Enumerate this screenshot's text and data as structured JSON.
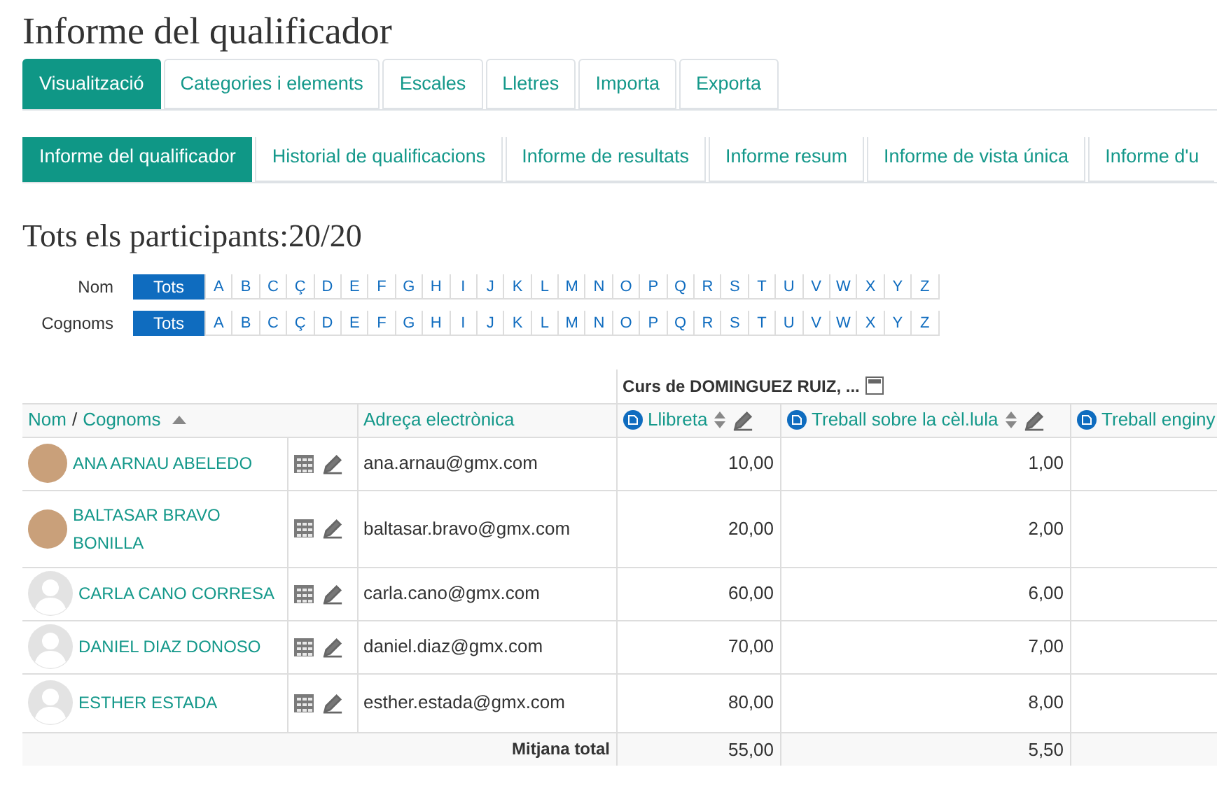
{
  "page_title": "Informe del qualificador",
  "main_tabs": [
    {
      "label": "Visualització",
      "selected": true
    },
    {
      "label": "Categories i elements",
      "selected": false
    },
    {
      "label": "Escales",
      "selected": false
    },
    {
      "label": "Lletres",
      "selected": false
    },
    {
      "label": "Importa",
      "selected": false
    },
    {
      "label": "Exporta",
      "selected": false
    }
  ],
  "sub_tabs": [
    {
      "label": "Informe del qualificador",
      "selected": true
    },
    {
      "label": "Historial de qualificacions",
      "selected": false
    },
    {
      "label": "Informe de resultats",
      "selected": false
    },
    {
      "label": "Informe resum",
      "selected": false
    },
    {
      "label": "Informe de vista única",
      "selected": false
    },
    {
      "label": "Informe d'u",
      "selected": false
    }
  ],
  "participants_heading": "Tots els participants:20/20",
  "initial_filters": [
    {
      "label": "Nom",
      "options": [
        {
          "label": "Tots",
          "selected": true
        },
        {
          "label": "A",
          "selected": false
        },
        {
          "label": "B",
          "selected": false
        },
        {
          "label": "C",
          "selected": false
        },
        {
          "label": "Ç",
          "selected": false
        },
        {
          "label": "D",
          "selected": false
        },
        {
          "label": "E",
          "selected": false
        },
        {
          "label": "F",
          "selected": false
        },
        {
          "label": "G",
          "selected": false
        },
        {
          "label": "H",
          "selected": false
        },
        {
          "label": "I",
          "selected": false
        },
        {
          "label": "J",
          "selected": false
        },
        {
          "label": "K",
          "selected": false
        },
        {
          "label": "L",
          "selected": false
        },
        {
          "label": "M",
          "selected": false
        },
        {
          "label": "N",
          "selected": false
        },
        {
          "label": "O",
          "selected": false
        },
        {
          "label": "P",
          "selected": false
        },
        {
          "label": "Q",
          "selected": false
        },
        {
          "label": "R",
          "selected": false
        },
        {
          "label": "S",
          "selected": false
        },
        {
          "label": "T",
          "selected": false
        },
        {
          "label": "U",
          "selected": false
        },
        {
          "label": "V",
          "selected": false
        },
        {
          "label": "W",
          "selected": false
        },
        {
          "label": "X",
          "selected": false
        },
        {
          "label": "Y",
          "selected": false
        },
        {
          "label": "Z",
          "selected": false
        }
      ]
    },
    {
      "label": "Cognoms",
      "options": [
        {
          "label": "Tots",
          "selected": true
        },
        {
          "label": "A",
          "selected": false
        },
        {
          "label": "B",
          "selected": false
        },
        {
          "label": "C",
          "selected": false
        },
        {
          "label": "Ç",
          "selected": false
        },
        {
          "label": "D",
          "selected": false
        },
        {
          "label": "E",
          "selected": false
        },
        {
          "label": "F",
          "selected": false
        },
        {
          "label": "G",
          "selected": false
        },
        {
          "label": "H",
          "selected": false
        },
        {
          "label": "I",
          "selected": false
        },
        {
          "label": "J",
          "selected": false
        },
        {
          "label": "K",
          "selected": false
        },
        {
          "label": "L",
          "selected": false
        },
        {
          "label": "M",
          "selected": false
        },
        {
          "label": "N",
          "selected": false
        },
        {
          "label": "O",
          "selected": false
        },
        {
          "label": "P",
          "selected": false
        },
        {
          "label": "Q",
          "selected": false
        },
        {
          "label": "R",
          "selected": false
        },
        {
          "label": "S",
          "selected": false
        },
        {
          "label": "T",
          "selected": false
        },
        {
          "label": "U",
          "selected": false
        },
        {
          "label": "V",
          "selected": false
        },
        {
          "label": "W",
          "selected": false
        },
        {
          "label": "X",
          "selected": false
        },
        {
          "label": "Y",
          "selected": false
        },
        {
          "label": "Z",
          "selected": false
        }
      ]
    }
  ],
  "grades_table": {
    "course_header": "Curs de DOMINGUEZ RUIZ, ...",
    "name_header": {
      "first": "Nom",
      "separator": "/",
      "last": "Cognoms"
    },
    "email_header": "Adreça electrònica",
    "grade_items": [
      "Llibreta",
      "Treball sobre la cèl.lula",
      "Treball enginy"
    ],
    "rows": [
      {
        "name": "ANA ARNAU ABELEDO",
        "kind": "photo",
        "email": "ana.arnau@gmx.com",
        "grades": [
          "10,00",
          "1,00"
        ]
      },
      {
        "name": "BALTASAR BRAVO BONILLA",
        "kind": "photo",
        "email": "baltasar.bravo@gmx.com",
        "grades": [
          "20,00",
          "2,00"
        ]
      },
      {
        "name": "CARLA CANO CORRESA",
        "kind": "default",
        "email": "carla.cano@gmx.com",
        "grades": [
          "60,00",
          "6,00"
        ]
      },
      {
        "name": "DANIEL DIAZ DONOSO",
        "kind": "default",
        "email": "daniel.diaz@gmx.com",
        "grades": [
          "70,00",
          "7,00"
        ]
      },
      {
        "name": "ESTHER ESTADA",
        "kind": "default",
        "email": "esther.estada@gmx.com",
        "grades": [
          "80,00",
          "8,00"
        ]
      }
    ],
    "footer": {
      "label": "Mitjana total",
      "grades": [
        "55,00",
        "5,50"
      ]
    }
  }
}
